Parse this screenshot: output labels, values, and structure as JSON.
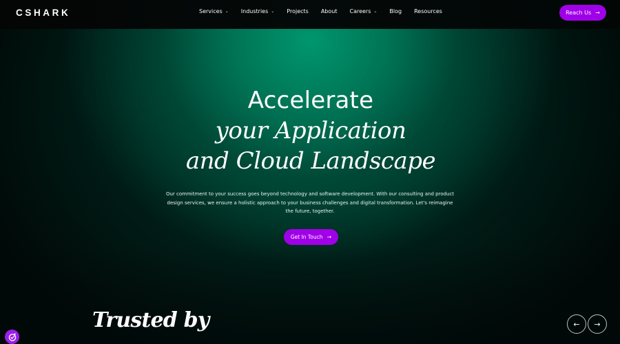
{
  "brand": {
    "logo": "CSHARK",
    "accent_color": "#a000e8"
  },
  "nav": {
    "items": [
      {
        "label": "Services",
        "has_dropdown": true
      },
      {
        "label": "Industries",
        "has_dropdown": true
      },
      {
        "label": "Projects",
        "has_dropdown": false
      },
      {
        "label": "About",
        "has_dropdown": false
      },
      {
        "label": "Careers",
        "has_dropdown": true
      },
      {
        "label": "Blog",
        "has_dropdown": false
      },
      {
        "label": "Resources",
        "has_dropdown": false
      }
    ],
    "dropdown_icon": "⌄",
    "cta_label": "Reach Us",
    "cta_icon": "→"
  },
  "hero": {
    "title_line1": "Accelerate",
    "title_line2": "your Application",
    "title_line3": "and Cloud Landscape",
    "description": "Our commitment to your success goes beyond technology and software development. With our consulting and product design services, we ensure a holistic approach to your business challenges and digital transformation. Let's reimagine the future, together.",
    "cta_label": "Get In Touch",
    "cta_icon": "→"
  },
  "trusted": {
    "heading": "Trusted by",
    "prev_icon": "←",
    "next_icon": "→"
  },
  "accessibility": {
    "icon": "accessibility-icon"
  }
}
